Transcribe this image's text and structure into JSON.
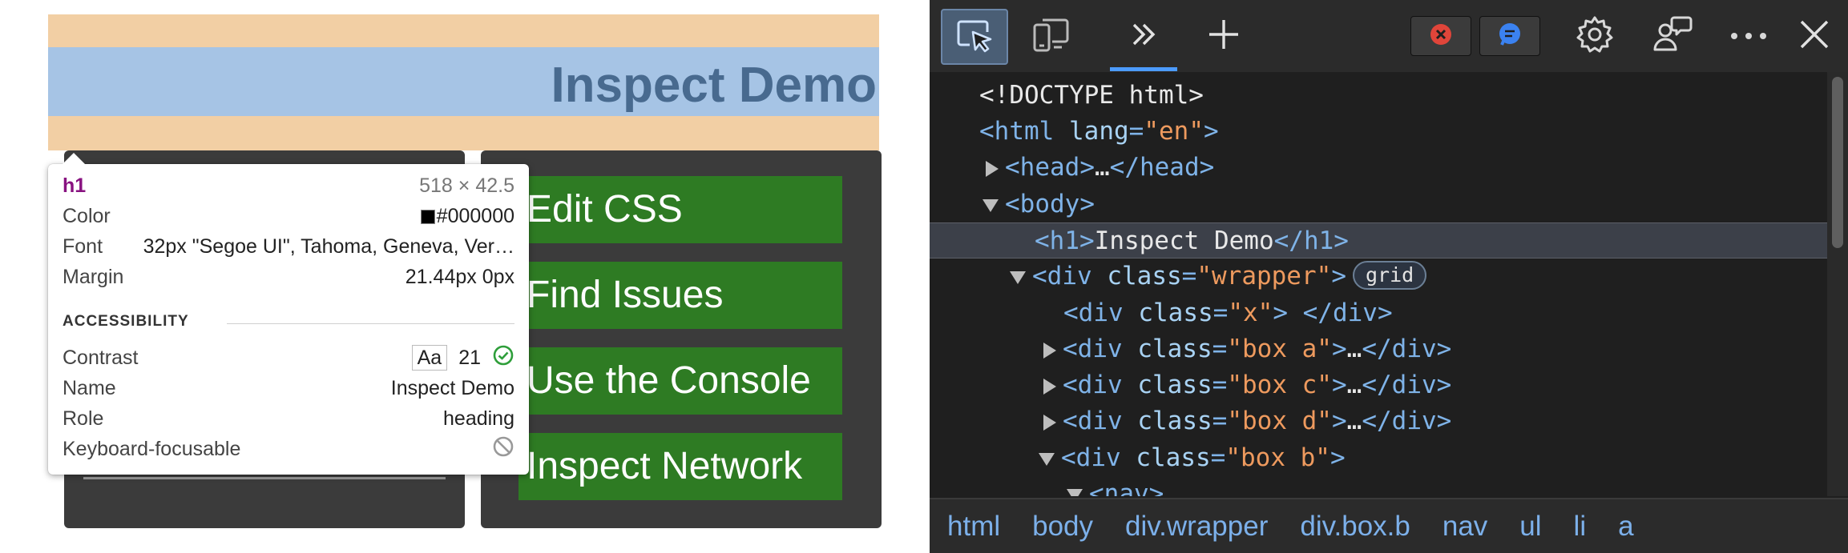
{
  "page": {
    "heading": "Inspect Demo",
    "nav_links": [
      "Edit CSS",
      "Find Issues",
      "Use the Console",
      "Inspect Network"
    ]
  },
  "tooltip": {
    "tag": "h1",
    "size": "518 × 42.5",
    "color_label": "Color",
    "color_value": "#000000",
    "font_label": "Font",
    "font_value": "32px \"Segoe UI\", Tahoma, Geneva, Ver…",
    "margin_label": "Margin",
    "margin_value": "21.44px 0px",
    "accessibility_title": "ACCESSIBILITY",
    "contrast_label": "Contrast",
    "contrast_sample": "Aa",
    "contrast_value": "21",
    "name_label": "Name",
    "name_value": "Inspect Demo",
    "role_label": "Role",
    "role_value": "heading",
    "keyboard_label": "Keyboard-focusable"
  },
  "dom_tree": {
    "doctype": "<!DOCTYPE html>",
    "html_open": "<html",
    "html_attr": "lang",
    "html_val": "\"en\"",
    "head_open": "<head>",
    "head_close": "</head>",
    "ellipsis": "…",
    "body_open": "<body>",
    "h1_open": "<h1>",
    "h1_text": "Inspect Demo",
    "h1_close": "</h1>",
    "div_open": "<div",
    "class_attr": "class",
    "wrapper_val": "\"wrapper\"",
    "grid_badge": "grid",
    "x_val": "\"x\"",
    "box_a_val": "\"box a\"",
    "box_c_val": "\"box c\"",
    "box_d_val": "\"box d\"",
    "box_b_val": "\"box b\"",
    "div_close": "</div>",
    "nav_open": "<nav>"
  },
  "breadcrumbs": [
    "html",
    "body",
    "div.wrapper",
    "div.box.b",
    "nav",
    "ul",
    "li",
    "a"
  ],
  "icons": {
    "inspect": "inspect-element-icon",
    "device": "device-emulation-icon",
    "more_tabs": "more-tabs-icon",
    "add": "add-tab-icon",
    "errors": "error-icon",
    "issues": "issues-icon",
    "settings": "gear-icon",
    "customize": "customize-icon",
    "menu": "more-options-icon",
    "close": "close-icon"
  },
  "colors": {
    "nav_green": "#2e7b23",
    "heading_band": "#a6c4e5",
    "peach_band": "#f2cfa4",
    "panel_dark": "#3b3b3b",
    "devtools_bg": "#1f1f1f",
    "tag_blue": "#7fb3e8",
    "attr_value_orange": "#ee9a5e"
  }
}
